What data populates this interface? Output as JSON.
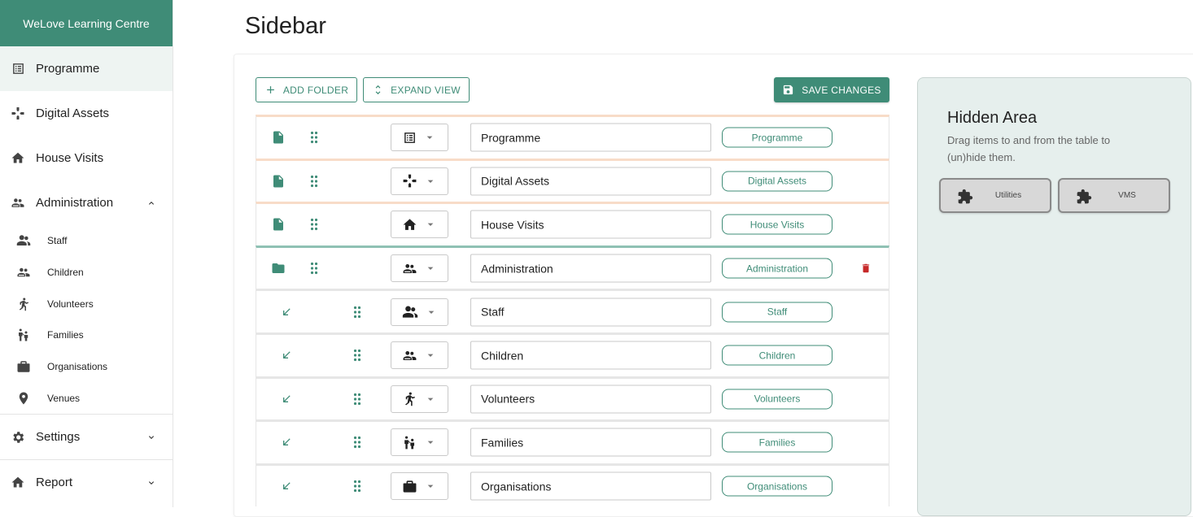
{
  "app": {
    "brand": "WeLove Learning Centre"
  },
  "sidebar": {
    "items": [
      {
        "label": "Programme",
        "icon": "list-icon"
      },
      {
        "label": "Digital Assets",
        "icon": "gamepad-icon"
      },
      {
        "label": "House Visits",
        "icon": "home-icon"
      },
      {
        "label": "Administration",
        "icon": "people-icon",
        "expanded": true
      }
    ],
    "sub_items": [
      {
        "label": "Staff",
        "icon": "group-icon"
      },
      {
        "label": "Children",
        "icon": "people-icon"
      },
      {
        "label": "Volunteers",
        "icon": "person-walking-icon"
      },
      {
        "label": "Families",
        "icon": "family-icon"
      },
      {
        "label": "Organisations",
        "icon": "briefcase-icon"
      },
      {
        "label": "Venues",
        "icon": "location-pin-icon"
      }
    ],
    "bottom_items": [
      {
        "label": "Settings",
        "icon": "gear-icon"
      },
      {
        "label": "Report",
        "icon": "home-icon"
      }
    ]
  },
  "page": {
    "title": "Sidebar"
  },
  "toolbar": {
    "add_folder": "ADD FOLDER",
    "expand_view": "EXPAND VIEW",
    "save_changes": "SAVE CHANGES"
  },
  "rows": [
    {
      "type": "page",
      "icon": "list-icon",
      "name": "Programme",
      "pill": "Programme"
    },
    {
      "type": "page",
      "icon": "gamepad-icon",
      "name": "Digital Assets",
      "pill": "Digital Assets"
    },
    {
      "type": "page",
      "icon": "home-icon",
      "name": "House Visits",
      "pill": "House Visits"
    },
    {
      "type": "folder",
      "icon": "people-icon",
      "name": "Administration",
      "pill": "Administration"
    },
    {
      "type": "child",
      "icon": "group-icon",
      "name": "Staff",
      "pill": "Staff"
    },
    {
      "type": "child",
      "icon": "people-icon",
      "name": "Children",
      "pill": "Children"
    },
    {
      "type": "child",
      "icon": "person-walking-icon",
      "name": "Volunteers",
      "pill": "Volunteers"
    },
    {
      "type": "child",
      "icon": "family-icon",
      "name": "Families",
      "pill": "Families"
    },
    {
      "type": "child",
      "icon": "briefcase-icon",
      "name": "Organisations",
      "pill": "Organisations"
    }
  ],
  "hidden_area": {
    "title": "Hidden Area",
    "description": "Drag items to and from the table to (un)hide them.",
    "chips": [
      {
        "label": "Utilities",
        "icon": "puzzle-icon"
      },
      {
        "label": "VMS",
        "icon": "puzzle-icon"
      }
    ]
  },
  "colors": {
    "accent": "#3f8c77",
    "danger": "#c62828",
    "hidden_bg": "#e6efed"
  }
}
